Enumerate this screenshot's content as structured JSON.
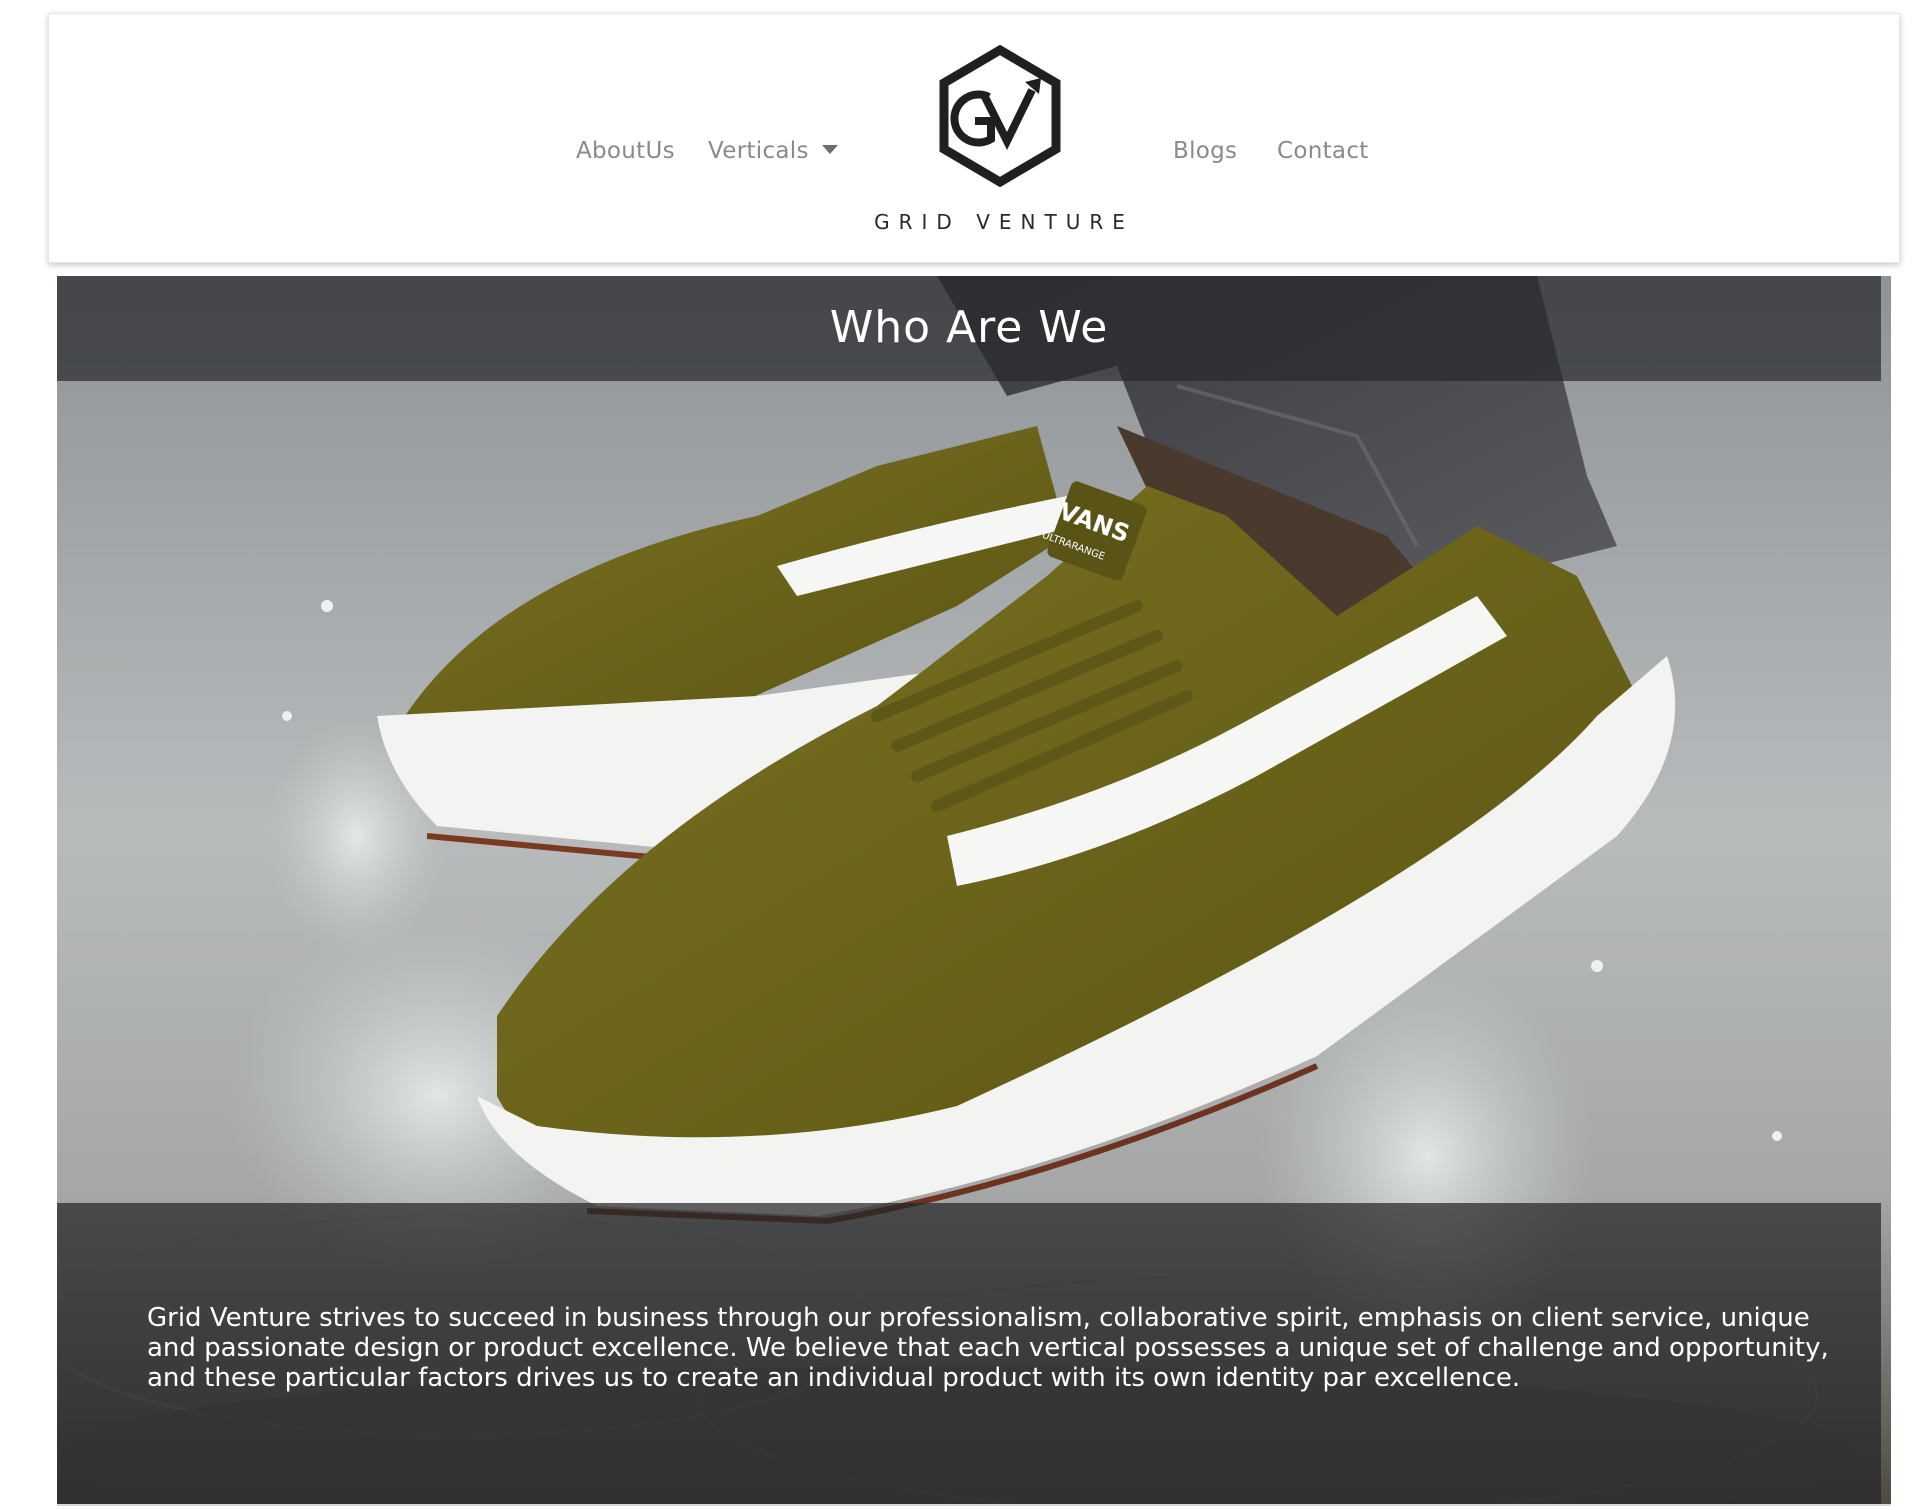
{
  "header": {
    "nav_left": [
      {
        "label": "AboutUs"
      },
      {
        "label": "Verticals",
        "has_dropdown": true
      }
    ],
    "nav_right": [
      {
        "label": "Blogs"
      },
      {
        "label": "Contact"
      }
    ],
    "logo": {
      "monogram": "GV",
      "wordmark": "GRID VENTURE",
      "icons": [
        "hexagon-logo-icon",
        "arrow-up-right-icon"
      ]
    },
    "dropdown_icon": "caret-down-icon"
  },
  "hero": {
    "title": "Who Are We",
    "paragraph": "Grid Venture strives to succeed in business through our professionalism, collaborative spirit, emphasis on client service, unique and passionate design or product excellence. We believe that each vertical possesses a unique set of challenge and opportunity, and these particular factors drives us to create an individual product with its own identity par excellence.",
    "image": {
      "description_icon": "sneaker-splash-photo",
      "shoe_brand_text": "VANS",
      "shoe_label_text": "ULTRARANGE"
    }
  },
  "colors": {
    "nav_text": "#8a8a8a",
    "logo_dark": "#1f1f1f",
    "overlay": "#28292e",
    "shoe_olive": "#6b6416",
    "sole_white": "#f2f2f2"
  }
}
